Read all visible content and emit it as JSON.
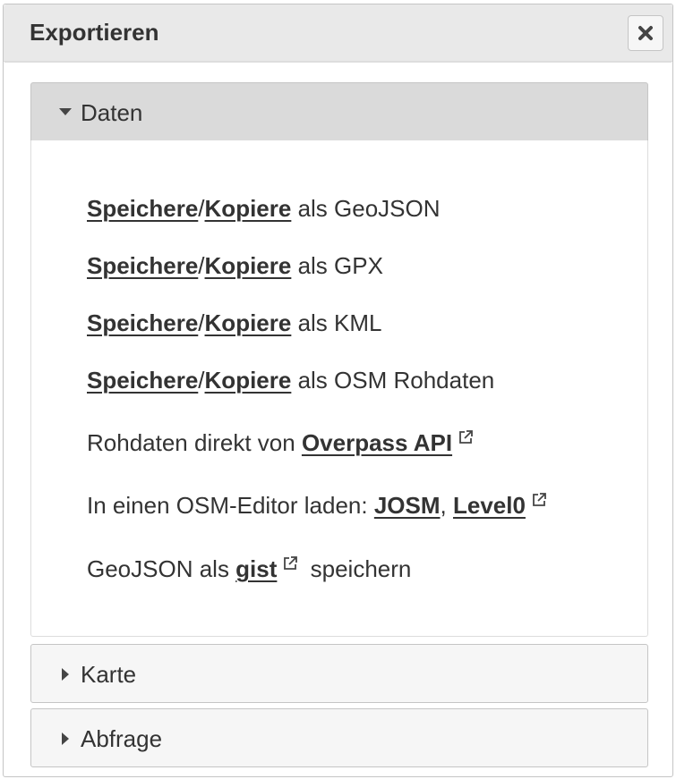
{
  "dialog": {
    "title": "Exportieren",
    "close_icon": "close-icon"
  },
  "accordion": {
    "data": {
      "label": "Daten",
      "expanded": true,
      "rows": {
        "geojson": {
          "save": "Speichere",
          "sep": "/",
          "copy": "Kopiere",
          "suffix": " als GeoJSON"
        },
        "gpx": {
          "save": "Speichere",
          "sep": "/",
          "copy": "Kopiere",
          "suffix": " als GPX"
        },
        "kml": {
          "save": "Speichere",
          "sep": "/",
          "copy": "Kopiere",
          "suffix": " als KML"
        },
        "osm": {
          "save": "Speichere",
          "sep": "/",
          "copy": "Kopiere",
          "suffix": " als OSM Rohdaten"
        },
        "raw": {
          "prefix": "Rohdaten direkt von ",
          "link": "Overpass API"
        },
        "editor": {
          "prefix": "In einen OSM-Editor laden: ",
          "josm": "JOSM",
          "sep": ", ",
          "level0": "Level0"
        },
        "gist": {
          "prefix": "GeoJSON als ",
          "link": "gist",
          "suffix": " speichern"
        }
      }
    },
    "map": {
      "label": "Karte",
      "expanded": false
    },
    "query": {
      "label": "Abfrage",
      "expanded": false
    }
  },
  "icons": {
    "external": "external-link-icon",
    "expanded": "triangle-down-icon",
    "collapsed": "triangle-right-icon"
  }
}
